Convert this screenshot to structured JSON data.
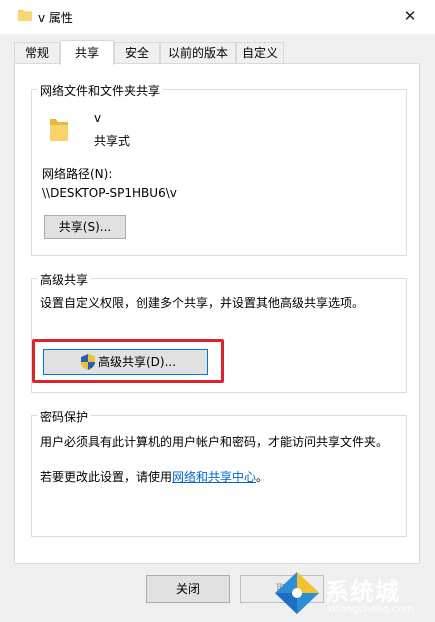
{
  "window": {
    "title": "v 属性",
    "close_glyph": "✕"
  },
  "tabs": [
    {
      "label": "常规",
      "active": false
    },
    {
      "label": "共享",
      "active": true
    },
    {
      "label": "安全",
      "active": false
    },
    {
      "label": "以前的版本",
      "active": false
    },
    {
      "label": "自定义",
      "active": false
    }
  ],
  "network_sharing": {
    "heading": "网络文件和文件夹共享",
    "folder_name": "v",
    "share_state": "共享式",
    "path_label": "网络路径(N):",
    "path_value": "\\\\DESKTOP-SP1HBU6\\v",
    "share_button": "共享(S)..."
  },
  "advanced_sharing": {
    "heading": "高级共享",
    "description": "设置自定义权限，创建多个共享，并设置其他高级共享选项。",
    "button": "高级共享(D)...",
    "button_icon": "shield-icon",
    "highlight_color": "#d9252b"
  },
  "password_protection": {
    "heading": "密码保护",
    "description": "用户必须具有此计算机的用户帐户和密码，才能访问共享文件夹。",
    "change_prefix": "若要更改此设置，请使用",
    "change_link": "网络和共享中心",
    "change_suffix": "。"
  },
  "footer": {
    "close_button": "关闭",
    "cancel_button": "取"
  },
  "watermark": {
    "text": "系统城",
    "url": "xitongcheng.com"
  },
  "colors": {
    "folder": "#f4cf62",
    "link": "#0066cc",
    "focus_border": "#0078d7"
  }
}
